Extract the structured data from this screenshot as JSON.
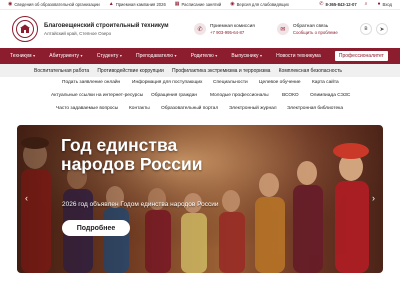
{
  "topbar": {
    "items": [
      {
        "icon": "eye-icon",
        "label": "Сведения об образовательной организации"
      },
      {
        "icon": "graduation-icon",
        "label": "Приемная кампания 2026"
      },
      {
        "icon": "calendar-icon",
        "label": "Расписание занятий"
      },
      {
        "icon": "eye-icon",
        "label": "Версия для слабовидящих"
      }
    ],
    "phone": "8-365-843-12-07",
    "login_label": "Вход"
  },
  "header": {
    "org_name": "Благовещенский строительный техникум",
    "org_address": "Алтайский край, Степное Озеро",
    "admission_title": "Приемная комиссия",
    "admission_phone": "+7 903-995-64-87",
    "feedback_title": "Обратная связь",
    "feedback_sub": "Сообщить о проблеме"
  },
  "nav_main": [
    {
      "label": "Техникум",
      "chevron": true,
      "active": false
    },
    {
      "label": "Абитуриенту",
      "chevron": true,
      "active": false
    },
    {
      "label": "Студенту",
      "chevron": true,
      "active": false
    },
    {
      "label": "Преподавателю",
      "chevron": true,
      "active": false
    },
    {
      "label": "Родителю",
      "chevron": true,
      "active": false
    },
    {
      "label": "Выпускнику",
      "chevron": true,
      "active": false
    },
    {
      "label": "Новости техникума",
      "chevron": false,
      "active": false
    },
    {
      "label": "Профессионалитет",
      "chevron": false,
      "active": true
    }
  ],
  "nav_sub": [
    "Воспитательная работа",
    "Противодействие коррупции",
    "Профилактика экстремизма и терроризма",
    "Комплексная безопасность"
  ],
  "links": {
    "row1": [
      "Подать заявление онлайн",
      "Информация для поступающих",
      "Специальности",
      "Целевое обучение",
      "Карта сайта"
    ],
    "row2": [
      "Актуальные ссылки на интернет-ресурсы",
      "Обращения граждан",
      "Молодые профессионалы",
      "ВСОКО",
      "Олимпиада СЭЗС"
    ],
    "row3": [
      "Часто задаваемые вопросы",
      "Контакты",
      "Образовательный портал",
      "Электронный журнал",
      "Электронная библиотека"
    ]
  },
  "hero": {
    "title_line1": "Год единства",
    "title_line2": "народов России",
    "subtitle": "2026 год объявлен Годом единства народов России",
    "button_label": "Подробнее",
    "prev_arrow": "‹",
    "next_arrow": "›"
  },
  "colors": {
    "brand": "#8c1d2f",
    "nav_sub_bg": "#f0f0f0"
  }
}
